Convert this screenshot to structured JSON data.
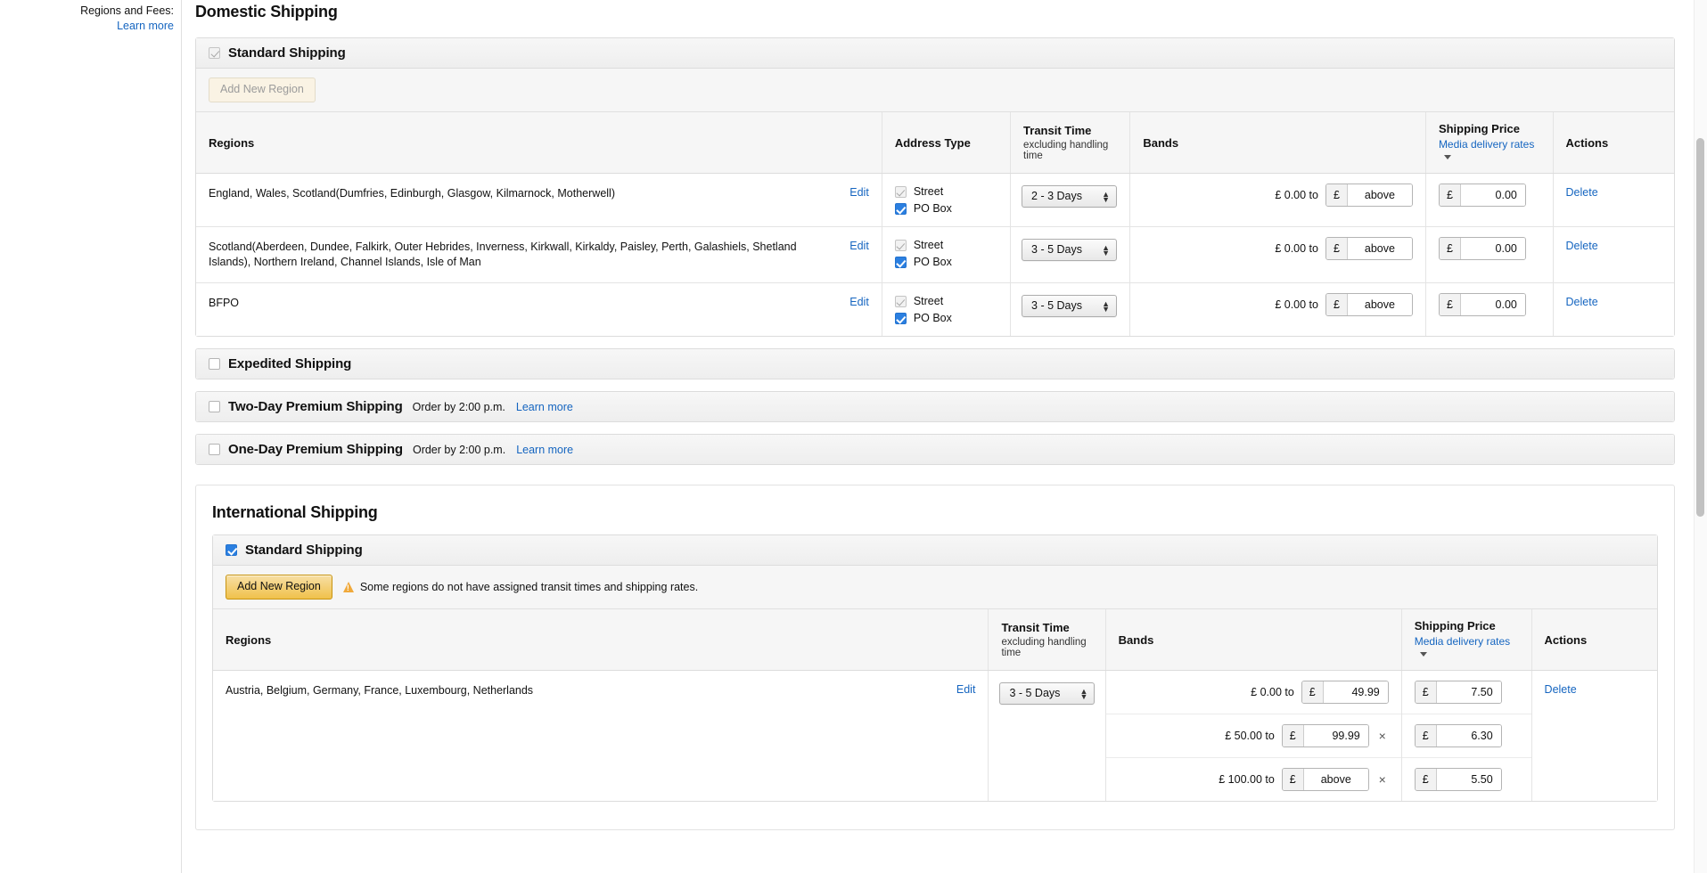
{
  "gutter": {
    "label": "Regions and Fees:",
    "link": "Learn more"
  },
  "sections": [
    {
      "title": "Domestic Shipping",
      "blocks": [
        {
          "title": "Standard Shipping",
          "checkbox_state": "checked-grey",
          "expanded": true,
          "toolbar": {
            "button_label": "Add New Region",
            "button_style": "disabled",
            "warning": null
          },
          "columns": {
            "regions": "Regions",
            "address_type": "Address Type",
            "transit_time": "Transit Time",
            "transit_time_sub": "excluding handling time",
            "bands": "Bands",
            "shipping_price": "Shipping Price",
            "shipping_price_link": "Media delivery rates",
            "actions": "Actions"
          },
          "rows": [
            {
              "region": "England, Wales, Scotland(Dumfries, Edinburgh, Glasgow, Kilmarnock, Motherwell)",
              "edit": "Edit",
              "address_types": [
                {
                  "label": "Street",
                  "state": "checked-grey"
                },
                {
                  "label": "PO Box",
                  "state": "checked-blue"
                }
              ],
              "transit": "2 - 3 Days",
              "bands": [
                {
                  "from": "£ 0.00 to",
                  "symbol": "£",
                  "value": "above",
                  "is_placeholder": true,
                  "removable": false
                }
              ],
              "prices": [
                {
                  "symbol": "£",
                  "value": "0.00"
                }
              ],
              "action": "Delete"
            },
            {
              "region": "Scotland(Aberdeen, Dundee, Falkirk, Outer Hebrides, Inverness, Kirkwall, Kirkaldy, Paisley, Perth, Galashiels, Shetland Islands), Northern Ireland, Channel Islands, Isle of Man",
              "edit": "Edit",
              "address_types": [
                {
                  "label": "Street",
                  "state": "checked-grey"
                },
                {
                  "label": "PO Box",
                  "state": "checked-blue"
                }
              ],
              "transit": "3 - 5 Days",
              "bands": [
                {
                  "from": "£ 0.00 to",
                  "symbol": "£",
                  "value": "above",
                  "is_placeholder": true,
                  "removable": false
                }
              ],
              "prices": [
                {
                  "symbol": "£",
                  "value": "0.00"
                }
              ],
              "action": "Delete"
            },
            {
              "region": "BFPO",
              "edit": "Edit",
              "address_types": [
                {
                  "label": "Street",
                  "state": "checked-grey"
                },
                {
                  "label": "PO Box",
                  "state": "checked-blue"
                }
              ],
              "transit": "3 - 5 Days",
              "bands": [
                {
                  "from": "£ 0.00 to",
                  "symbol": "£",
                  "value": "above",
                  "is_placeholder": true,
                  "removable": false
                }
              ],
              "prices": [
                {
                  "symbol": "£",
                  "value": "0.00"
                }
              ],
              "action": "Delete"
            }
          ]
        },
        {
          "title": "Expedited Shipping",
          "checkbox_state": "empty",
          "expanded": false,
          "note": "",
          "note_link": ""
        },
        {
          "title": "Two-Day Premium Shipping",
          "checkbox_state": "empty",
          "expanded": false,
          "note": "Order by 2:00 p.m.",
          "note_link": "Learn more"
        },
        {
          "title": "One-Day Premium Shipping",
          "checkbox_state": "empty",
          "expanded": false,
          "note": "Order by 2:00 p.m.",
          "note_link": "Learn more"
        }
      ]
    },
    {
      "title": "International Shipping",
      "blocks": [
        {
          "title": "Standard Shipping",
          "checkbox_state": "checked-blue",
          "expanded": true,
          "toolbar": {
            "button_label": "Add New Region",
            "button_style": "primary",
            "warning": "Some regions do not have assigned transit times and shipping rates."
          },
          "columns": {
            "regions": "Regions",
            "address_type": "",
            "transit_time": "Transit Time",
            "transit_time_sub": "excluding handling time",
            "bands": "Bands",
            "shipping_price": "Shipping Price",
            "shipping_price_link": "Media delivery rates",
            "actions": "Actions"
          },
          "rows": [
            {
              "region": "Austria, Belgium, Germany, France, Luxembourg, Netherlands",
              "edit": "Edit",
              "address_types": [],
              "transit": "3 - 5 Days",
              "bands": [
                {
                  "from": "£ 0.00 to",
                  "symbol": "£",
                  "value": "49.99",
                  "is_placeholder": false,
                  "removable": false
                },
                {
                  "from": "£ 50.00 to",
                  "symbol": "£",
                  "value": "99.99",
                  "is_placeholder": false,
                  "removable": true
                },
                {
                  "from": "£ 100.00 to",
                  "symbol": "£",
                  "value": "above",
                  "is_placeholder": true,
                  "removable": true
                }
              ],
              "prices": [
                {
                  "symbol": "£",
                  "value": "7.50"
                },
                {
                  "symbol": "£",
                  "value": "6.30"
                },
                {
                  "symbol": "£",
                  "value": "5.50"
                }
              ],
              "action": "Delete"
            }
          ]
        }
      ]
    }
  ],
  "icons": {
    "warning": "warning-triangle-icon",
    "caret": "chevron-down-icon",
    "remove_band": "×"
  },
  "colors": {
    "link": "#1565c0",
    "accent_button": "#f0c14b",
    "warning": "#f0a93b",
    "checkbox_checked": "#2b7fe0"
  }
}
